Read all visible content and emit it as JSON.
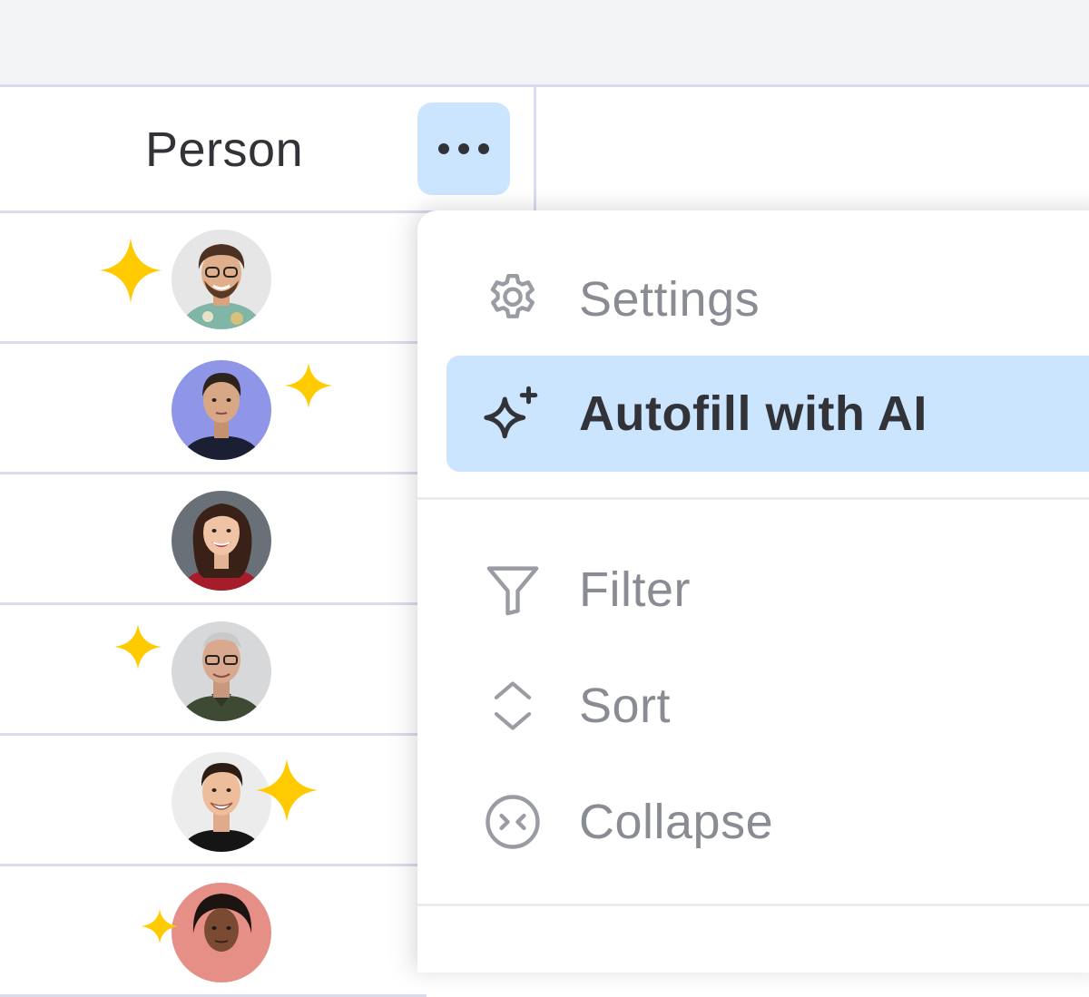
{
  "column": {
    "title": "Person"
  },
  "menu": {
    "items": [
      {
        "label": "Settings",
        "icon": "gear-icon"
      },
      {
        "label": "Autofill with AI",
        "icon": "sparkle-ai-icon",
        "active": true
      },
      {
        "label": "Filter",
        "icon": "filter-icon"
      },
      {
        "label": "Sort",
        "icon": "sort-icon"
      },
      {
        "label": "Collapse",
        "icon": "collapse-icon"
      }
    ]
  },
  "colors": {
    "accent": "#cce5ff",
    "sparkle": "#ffcb00",
    "divider": "#d9dcec",
    "text": "#323338",
    "muted": "#8a8c94"
  }
}
